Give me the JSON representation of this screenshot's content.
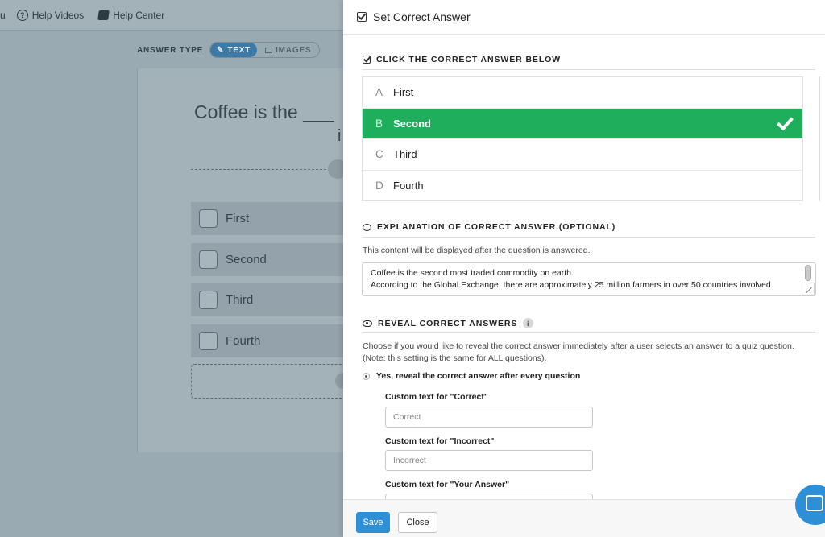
{
  "topbar": {
    "partial_left": "u",
    "help_videos": "Help Videos",
    "help_center": "Help Center"
  },
  "editor": {
    "answer_type_label": "ANSWER TYPE",
    "answer_type_text": "TEXT",
    "answer_type_images": "IMAGES",
    "question_line1": "Coffee is the ___",
    "question_line2": "i",
    "options": [
      "First",
      "Second",
      "Third",
      "Fourth"
    ]
  },
  "modal": {
    "title": "Set Correct Answer",
    "correct_section_title": "CLICK THE CORRECT ANSWER BELOW",
    "answers": [
      {
        "letter": "A",
        "text": "First",
        "selected": false
      },
      {
        "letter": "B",
        "text": "Second",
        "selected": true
      },
      {
        "letter": "C",
        "text": "Third",
        "selected": false
      },
      {
        "letter": "D",
        "text": "Fourth",
        "selected": false
      }
    ],
    "explanation_title": "EXPLANATION OF CORRECT ANSWER (OPTIONAL)",
    "explanation_note": "This content will be displayed after the question is answered.",
    "explanation_line1": "Coffee is the second most traded commodity on earth.",
    "explanation_line2": "According to the Global Exchange, there are approximately 25 million farmers in over 50 countries involved",
    "reveal_title": "REVEAL CORRECT ANSWERS",
    "reveal_info": "i",
    "reveal_note_line1": "Choose if you would like to reveal the correct answer immediately after a user selects an answer to a quiz question.",
    "reveal_note_line2": "(Note: this setting is the same for ALL questions).",
    "reveal_option": "Yes, reveal the correct answer after every question",
    "correct_label": "Custom text for \"Correct\"",
    "correct_placeholder": "Correct",
    "incorrect_label": "Custom text for \"Incorrect\"",
    "incorrect_placeholder": "Incorrect",
    "your_answer_label": "Custom text for \"Your Answer\"",
    "save_label": "Save",
    "close_label": "Close"
  },
  "colors": {
    "correct_green": "#1fae5b",
    "primary_blue": "#2d8fd6"
  }
}
